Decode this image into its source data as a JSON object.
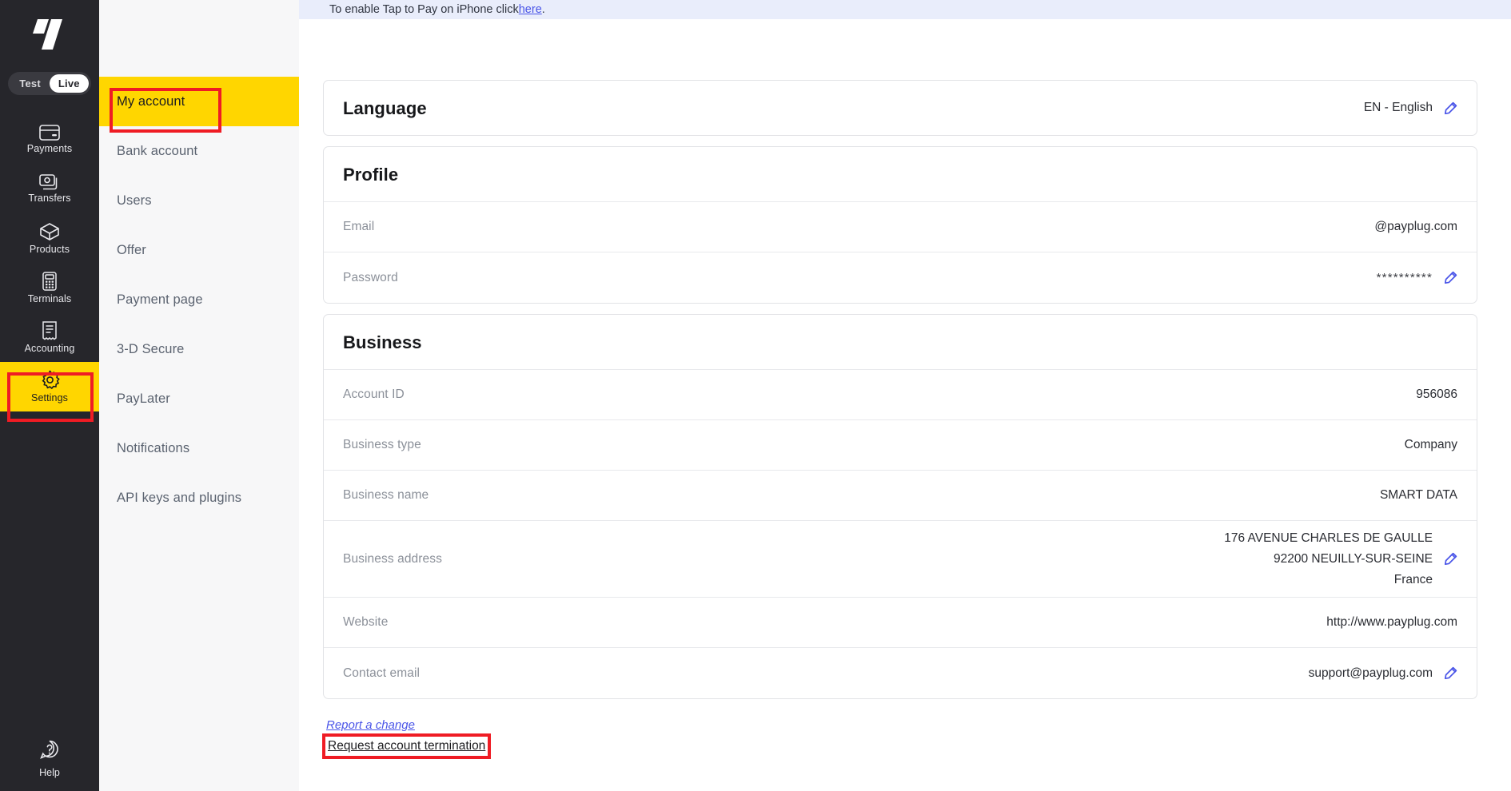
{
  "primary_nav": {
    "logo_name": "payplug-logo",
    "env_toggle": {
      "test_label": "Test",
      "live_label": "Live",
      "selected": "Live"
    },
    "items": [
      {
        "label": "Payments",
        "icon": "credit-card-icon",
        "selected": false
      },
      {
        "label": "Transfers",
        "icon": "banknotes-icon",
        "selected": false
      },
      {
        "label": "Products",
        "icon": "box-icon",
        "selected": false
      },
      {
        "label": "Terminals",
        "icon": "card-terminal-icon",
        "selected": false
      },
      {
        "label": "Accounting",
        "icon": "receipt-icon",
        "selected": false
      },
      {
        "label": "Settings",
        "icon": "gear-icon",
        "selected": true
      }
    ],
    "help": {
      "label": "Help",
      "icon": "question-bubble-icon"
    }
  },
  "secondary_nav": {
    "items": [
      {
        "label": "My account",
        "active": true
      },
      {
        "label": "Bank account",
        "active": false
      },
      {
        "label": "Users",
        "active": false
      },
      {
        "label": "Offer",
        "active": false
      },
      {
        "label": "Payment page",
        "active": false
      },
      {
        "label": "3-D Secure",
        "active": false
      },
      {
        "label": "PayLater",
        "active": false
      },
      {
        "label": "Notifications",
        "active": false
      },
      {
        "label": "API keys and plugins",
        "active": false
      }
    ]
  },
  "notice": {
    "text_before": "To enable Tap to Pay on iPhone click ",
    "link_label": "here",
    "text_after": "."
  },
  "language_card": {
    "title": "Language",
    "value": "EN - English",
    "edit_icon": "pencil-icon"
  },
  "profile_card": {
    "title": "Profile",
    "rows": [
      {
        "label": "Email",
        "value": "@payplug.com",
        "editable": false
      },
      {
        "label": "Password",
        "value": "**********",
        "editable": true
      }
    ]
  },
  "business_card": {
    "title": "Business",
    "rows": [
      {
        "label": "Account ID",
        "value": "956086",
        "editable": false
      },
      {
        "label": "Business type",
        "value": "Company",
        "editable": false
      },
      {
        "label": "Business name",
        "value": "SMART DATA",
        "editable": false
      },
      {
        "label": "Website",
        "value": "http://www.payplug.com",
        "editable": false
      },
      {
        "label": "Contact email",
        "value": "support@payplug.com",
        "editable": true
      }
    ],
    "address": {
      "label": "Business address",
      "line1": "176 AVENUE CHARLES DE GAULLE",
      "line2": "92200  NEUILLY-SUR-SEINE",
      "line3": "France",
      "editable": true
    }
  },
  "footer_links": {
    "report_label": "Report a change",
    "termination_label": "Request account termination"
  },
  "colors": {
    "brand_yellow": "#ffd600",
    "sidebar_dark": "#26262b",
    "link_blue": "#4a55e8",
    "annotation_red": "#ef1c24",
    "banner_bg": "#e9edfb"
  }
}
